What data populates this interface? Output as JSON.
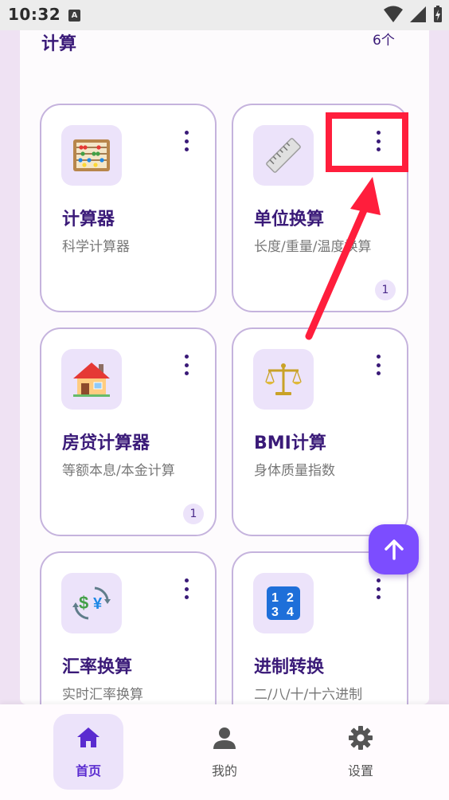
{
  "status_bar": {
    "time": "10:32",
    "notification_badge": "A"
  },
  "section": {
    "title": "计算",
    "count": "6个"
  },
  "cards": [
    {
      "title": "计算器",
      "desc": "科学计算器",
      "badge": null,
      "icon": "abacus-icon"
    },
    {
      "title": "单位换算",
      "desc": "长度/重量/温度换算",
      "badge": "1",
      "icon": "ruler-icon"
    },
    {
      "title": "房贷计算器",
      "desc": "等额本息/本金计算",
      "badge": "1",
      "icon": "house-icon"
    },
    {
      "title": "BMI计算",
      "desc": "身体质量指数",
      "badge": null,
      "icon": "balance-scale-icon"
    },
    {
      "title": "汇率换算",
      "desc": "实时汇率换算",
      "badge": null,
      "icon": "currency-exchange-icon"
    },
    {
      "title": "进制转换",
      "desc": "二/八/十/十六进制",
      "badge": null,
      "icon": "numbers-1234-icon"
    }
  ],
  "nav": {
    "home": "首页",
    "mine": "我的",
    "settings": "设置"
  },
  "colors": {
    "accent": "#7c4dff",
    "title": "#3a1a78",
    "card_border": "#c5b3dd",
    "annotation": "#ff1e3c"
  }
}
